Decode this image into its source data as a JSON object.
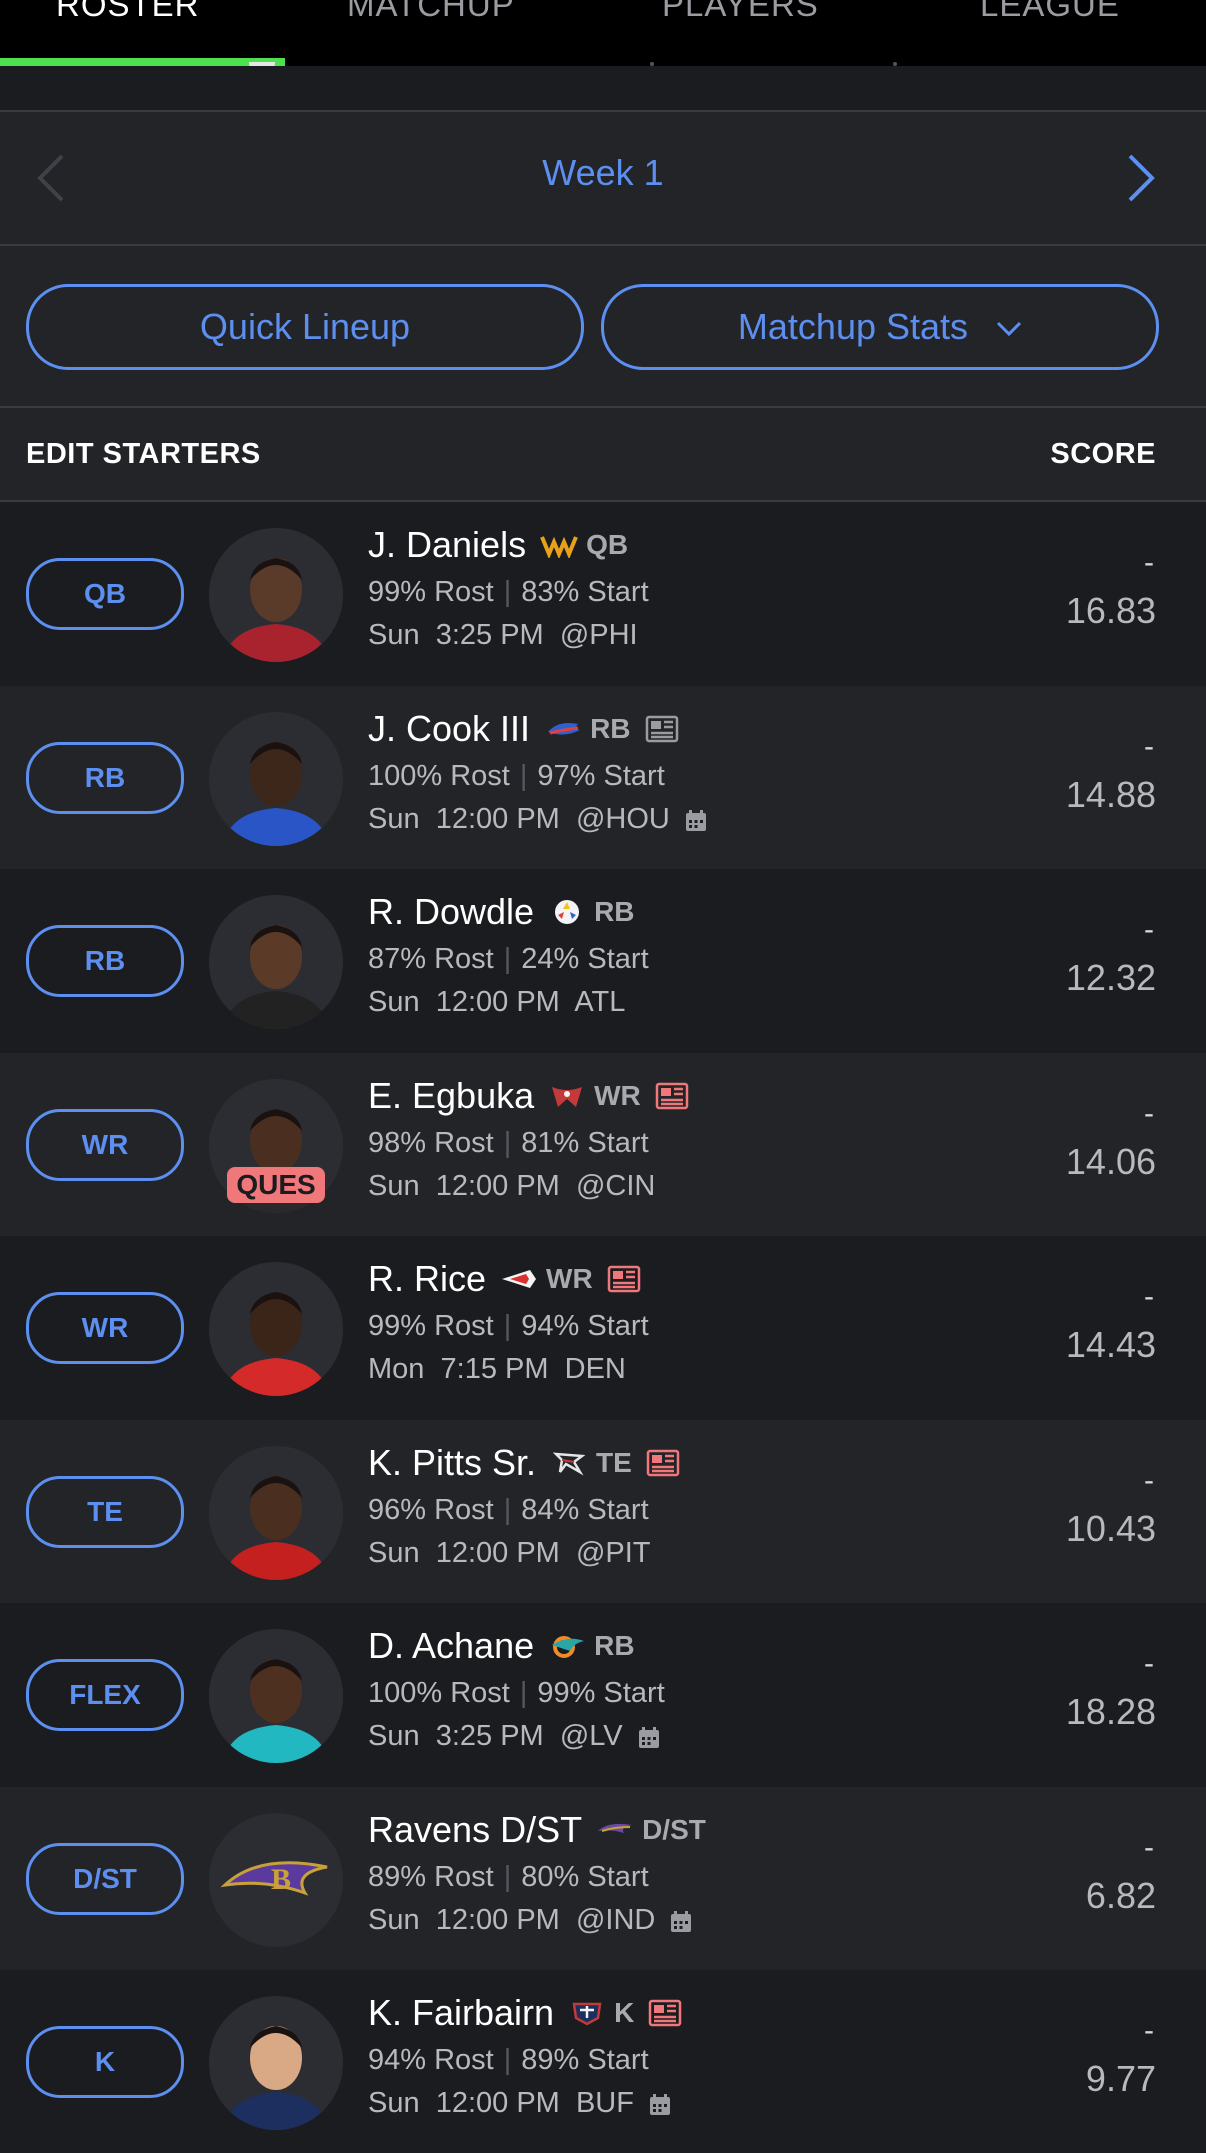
{
  "tabs": [
    {
      "label": "ROSTER",
      "active": true
    },
    {
      "label": "MATCHUP",
      "active": false
    },
    {
      "label": "PLAYERS",
      "active": false
    },
    {
      "label": "LEAGUE",
      "active": false
    }
  ],
  "colors": {
    "accent": "#5c8ff0",
    "tab_indicator": "#4ee04e",
    "ques_badge": "#f0777a",
    "news_icon": "#f0777a"
  },
  "week_nav": {
    "title": "Week 1",
    "prev_icon": "chevron-left-icon",
    "next_icon": "chevron-right-icon"
  },
  "actions": {
    "quick_lineup": "Quick Lineup",
    "matchup_stats": "Matchup Stats"
  },
  "header": {
    "left": "EDIT STARTERS",
    "right": "SCORE"
  },
  "players": [
    {
      "slot": "QB",
      "name": "J. Daniels",
      "team_icon": "commanders-logo-icon",
      "pos": "QB",
      "news": false,
      "rost": "99% Rost",
      "start": "83% Start",
      "game": "Sun  3:25 PM  @PHI",
      "calendar": false,
      "score_top": "-",
      "score": "16.83",
      "status": ""
    },
    {
      "slot": "RB",
      "name": "J. Cook III",
      "team_icon": "bills-logo-icon",
      "pos": "RB",
      "news": true,
      "rost": "100% Rost",
      "start": "97% Start",
      "game": "Sun  12:00 PM  @HOU",
      "calendar": true,
      "score_top": "-",
      "score": "14.88",
      "status": ""
    },
    {
      "slot": "RB",
      "name": "R. Dowdle",
      "team_icon": "steelers-logo-icon",
      "pos": "RB",
      "news": false,
      "rost": "87% Rost",
      "start": "24% Start",
      "game": "Sun  12:00 PM  ATL",
      "calendar": false,
      "score_top": "-",
      "score": "12.32",
      "status": ""
    },
    {
      "slot": "WR",
      "name": "E. Egbuka",
      "team_icon": "buccaneers-logo-icon",
      "pos": "WR",
      "news": true,
      "rost": "98% Rost",
      "start": "81% Start",
      "game": "Sun  12:00 PM  @CIN",
      "calendar": false,
      "score_top": "-",
      "score": "14.06",
      "status": "QUES"
    },
    {
      "slot": "WR",
      "name": "R. Rice",
      "team_icon": "chiefs-logo-icon",
      "pos": "WR",
      "news": true,
      "rost": "99% Rost",
      "start": "94% Start",
      "game": "Mon  7:15 PM  DEN",
      "calendar": false,
      "score_top": "-",
      "score": "14.43",
      "status": ""
    },
    {
      "slot": "TE",
      "name": "K. Pitts Sr.",
      "team_icon": "falcons-logo-icon",
      "pos": "TE",
      "news": true,
      "rost": "96% Rost",
      "start": "84% Start",
      "game": "Sun  12:00 PM  @PIT",
      "calendar": false,
      "score_top": "-",
      "score": "10.43",
      "status": ""
    },
    {
      "slot": "FLEX",
      "name": "D. Achane",
      "team_icon": "dolphins-logo-icon",
      "pos": "RB",
      "news": false,
      "rost": "100% Rost",
      "start": "99% Start",
      "game": "Sun  3:25 PM  @LV",
      "calendar": true,
      "score_top": "-",
      "score": "18.28",
      "status": ""
    },
    {
      "slot": "D/ST",
      "name": "Ravens D/ST",
      "team_icon": "ravens-logo-icon",
      "pos": "D/ST",
      "news": false,
      "rost": "89% Rost",
      "start": "80% Start",
      "game": "Sun  12:00 PM  @IND",
      "calendar": true,
      "score_top": "-",
      "score": "6.82",
      "status": ""
    },
    {
      "slot": "K",
      "name": "K. Fairbairn",
      "team_icon": "texans-logo-icon",
      "pos": "K",
      "news": true,
      "rost": "94% Rost",
      "start": "89% Start",
      "game": "Sun  12:00 PM  BUF",
      "calendar": true,
      "score_top": "-",
      "score": "9.77",
      "status": ""
    }
  ]
}
